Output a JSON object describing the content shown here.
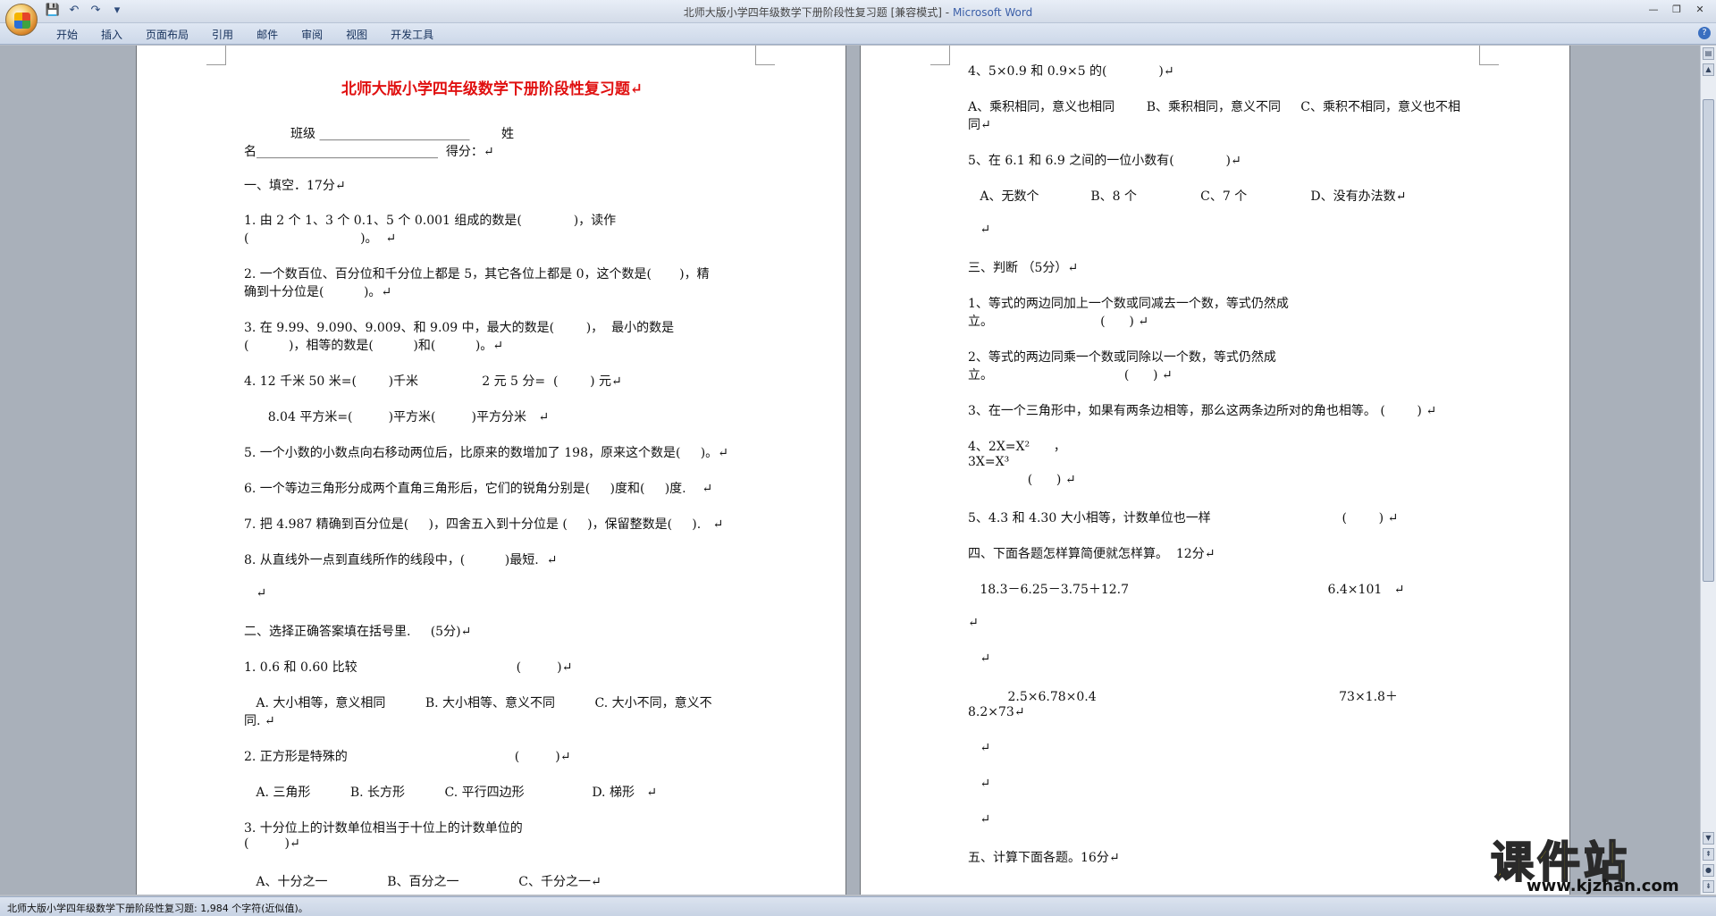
{
  "window": {
    "title": "北师大版小学四年级数学下册阶段性复习题 [兼容模式]",
    "separator": " - ",
    "app_name": "Microsoft Word"
  },
  "quick_access": [
    "💾",
    "↶",
    "↷",
    "▾"
  ],
  "ribbon": {
    "tabs": [
      "开始",
      "插入",
      "页面布局",
      "引用",
      "邮件",
      "审阅",
      "视图",
      "开发工具"
    ]
  },
  "page1": {
    "title": "北师大版小学四年级数学下册阶段性复习题↵",
    "lines": [
      "班级 ________________________        姓",
      "名_____________________________  得分：↵",
      "一、填空．17分↵",
      "1. 由 2 个 1、3 个 0.1、5 个 0.001 组成的数是(             )，读作",
      "(                            )。  ↵",
      "2. 一个数百位、百分位和千分位上都是 5，其它各位上都是 0，这个数是(       )，精",
      "确到十分位是(          )。↵",
      "3. 在 9.99、9.090、9.009、和 9.09 中，最大的数是(        )，  最小的数是",
      "(          )，相等的数是(          )和(          )。↵",
      "4. 12 千米 50 米=(        )千米                2 元 5 分=  (        ) 元↵",
      "      8.04 平方米=(         )平方米(         )平方分米   ↵",
      "5. 一个小数的小数点向右移动两位后，比原来的数增加了 198，原来这个数是(     )。↵",
      "6. 一个等边三角形分成两个直角三角形后，它们的锐角分别是(     )度和(     )度.    ↵",
      "7. 把 4.987 精确到百分位是(     )，四舍五入到十分位是 (     )，保留整数是(     ).   ↵",
      "8. 从直线外一点到直线所作的线段中，(          )最短.  ↵",
      "   ↵",
      "二、选择正确答案填在括号里.     (5分)↵",
      "1. 0.6 和 0.60 比较                                        (         )↵",
      "   A. 大小相等，意义相同          B. 大小相等、意义不同          C. 大小不同，意义不",
      "同. ↵",
      "2. 正方形是特殊的                                          (         )↵",
      "   A. 三角形          B. 长方形          C. 平行四边形                 D. 梯形   ↵",
      "3. 十分位上的计数单位相当于十位上的计数单位的",
      "(         )↵",
      "   A、十分之一               B、百分之一               C、千分之一↵"
    ]
  },
  "page2": {
    "lines": [
      "4、5×0.9 和 0.9×5 的(             )↵",
      "A、乘积相同，意义也相同        B、乘积相同，意义不同     C、乘积不相同，意义也不相",
      "同↵",
      "5、在 6.1 和 6.9 之间的一位小数有(             )↵",
      "   A、无数个             B、8 个                C、7 个                D、没有办法数↵",
      "   ↵",
      "三、判断 （5分）↵",
      "1、等式的两边同加上一个数或同减去一个数，等式仍然成",
      "立。                           (      ) ↵",
      "2、等式的两边同乘一个数或同除以一个数，等式仍然成",
      "立。                                 (      ) ↵",
      "3、在一个三角形中，如果有两条边相等，那么这两条边所对的角也相等。 (        ) ↵",
      "4、2X=X²      ，",
      "3X=X³",
      "               (      ) ↵",
      "5、4.3 和 4.30 大小相等，计数单位也一样                                 (        ) ↵",
      "四、下面各题怎样算简便就怎样算。  12分↵",
      "   18.3－6.25－3.75＋12.7                                                  6.4×101   ↵",
      "↵",
      "   ↵",
      "          2.5×6.78×0.4                                                             73×1.8＋",
      "8.2×73↵",
      "   ↵",
      "   ↵",
      "   ↵",
      "五、计算下面各题。16分↵"
    ]
  },
  "statusbar": {
    "text": "北师大版小学四年级数学下册阶段性复习题: 1,984 个字符(近似值)。"
  },
  "watermark": {
    "cn": "课件站",
    "url": "www.kjzhan.com"
  }
}
